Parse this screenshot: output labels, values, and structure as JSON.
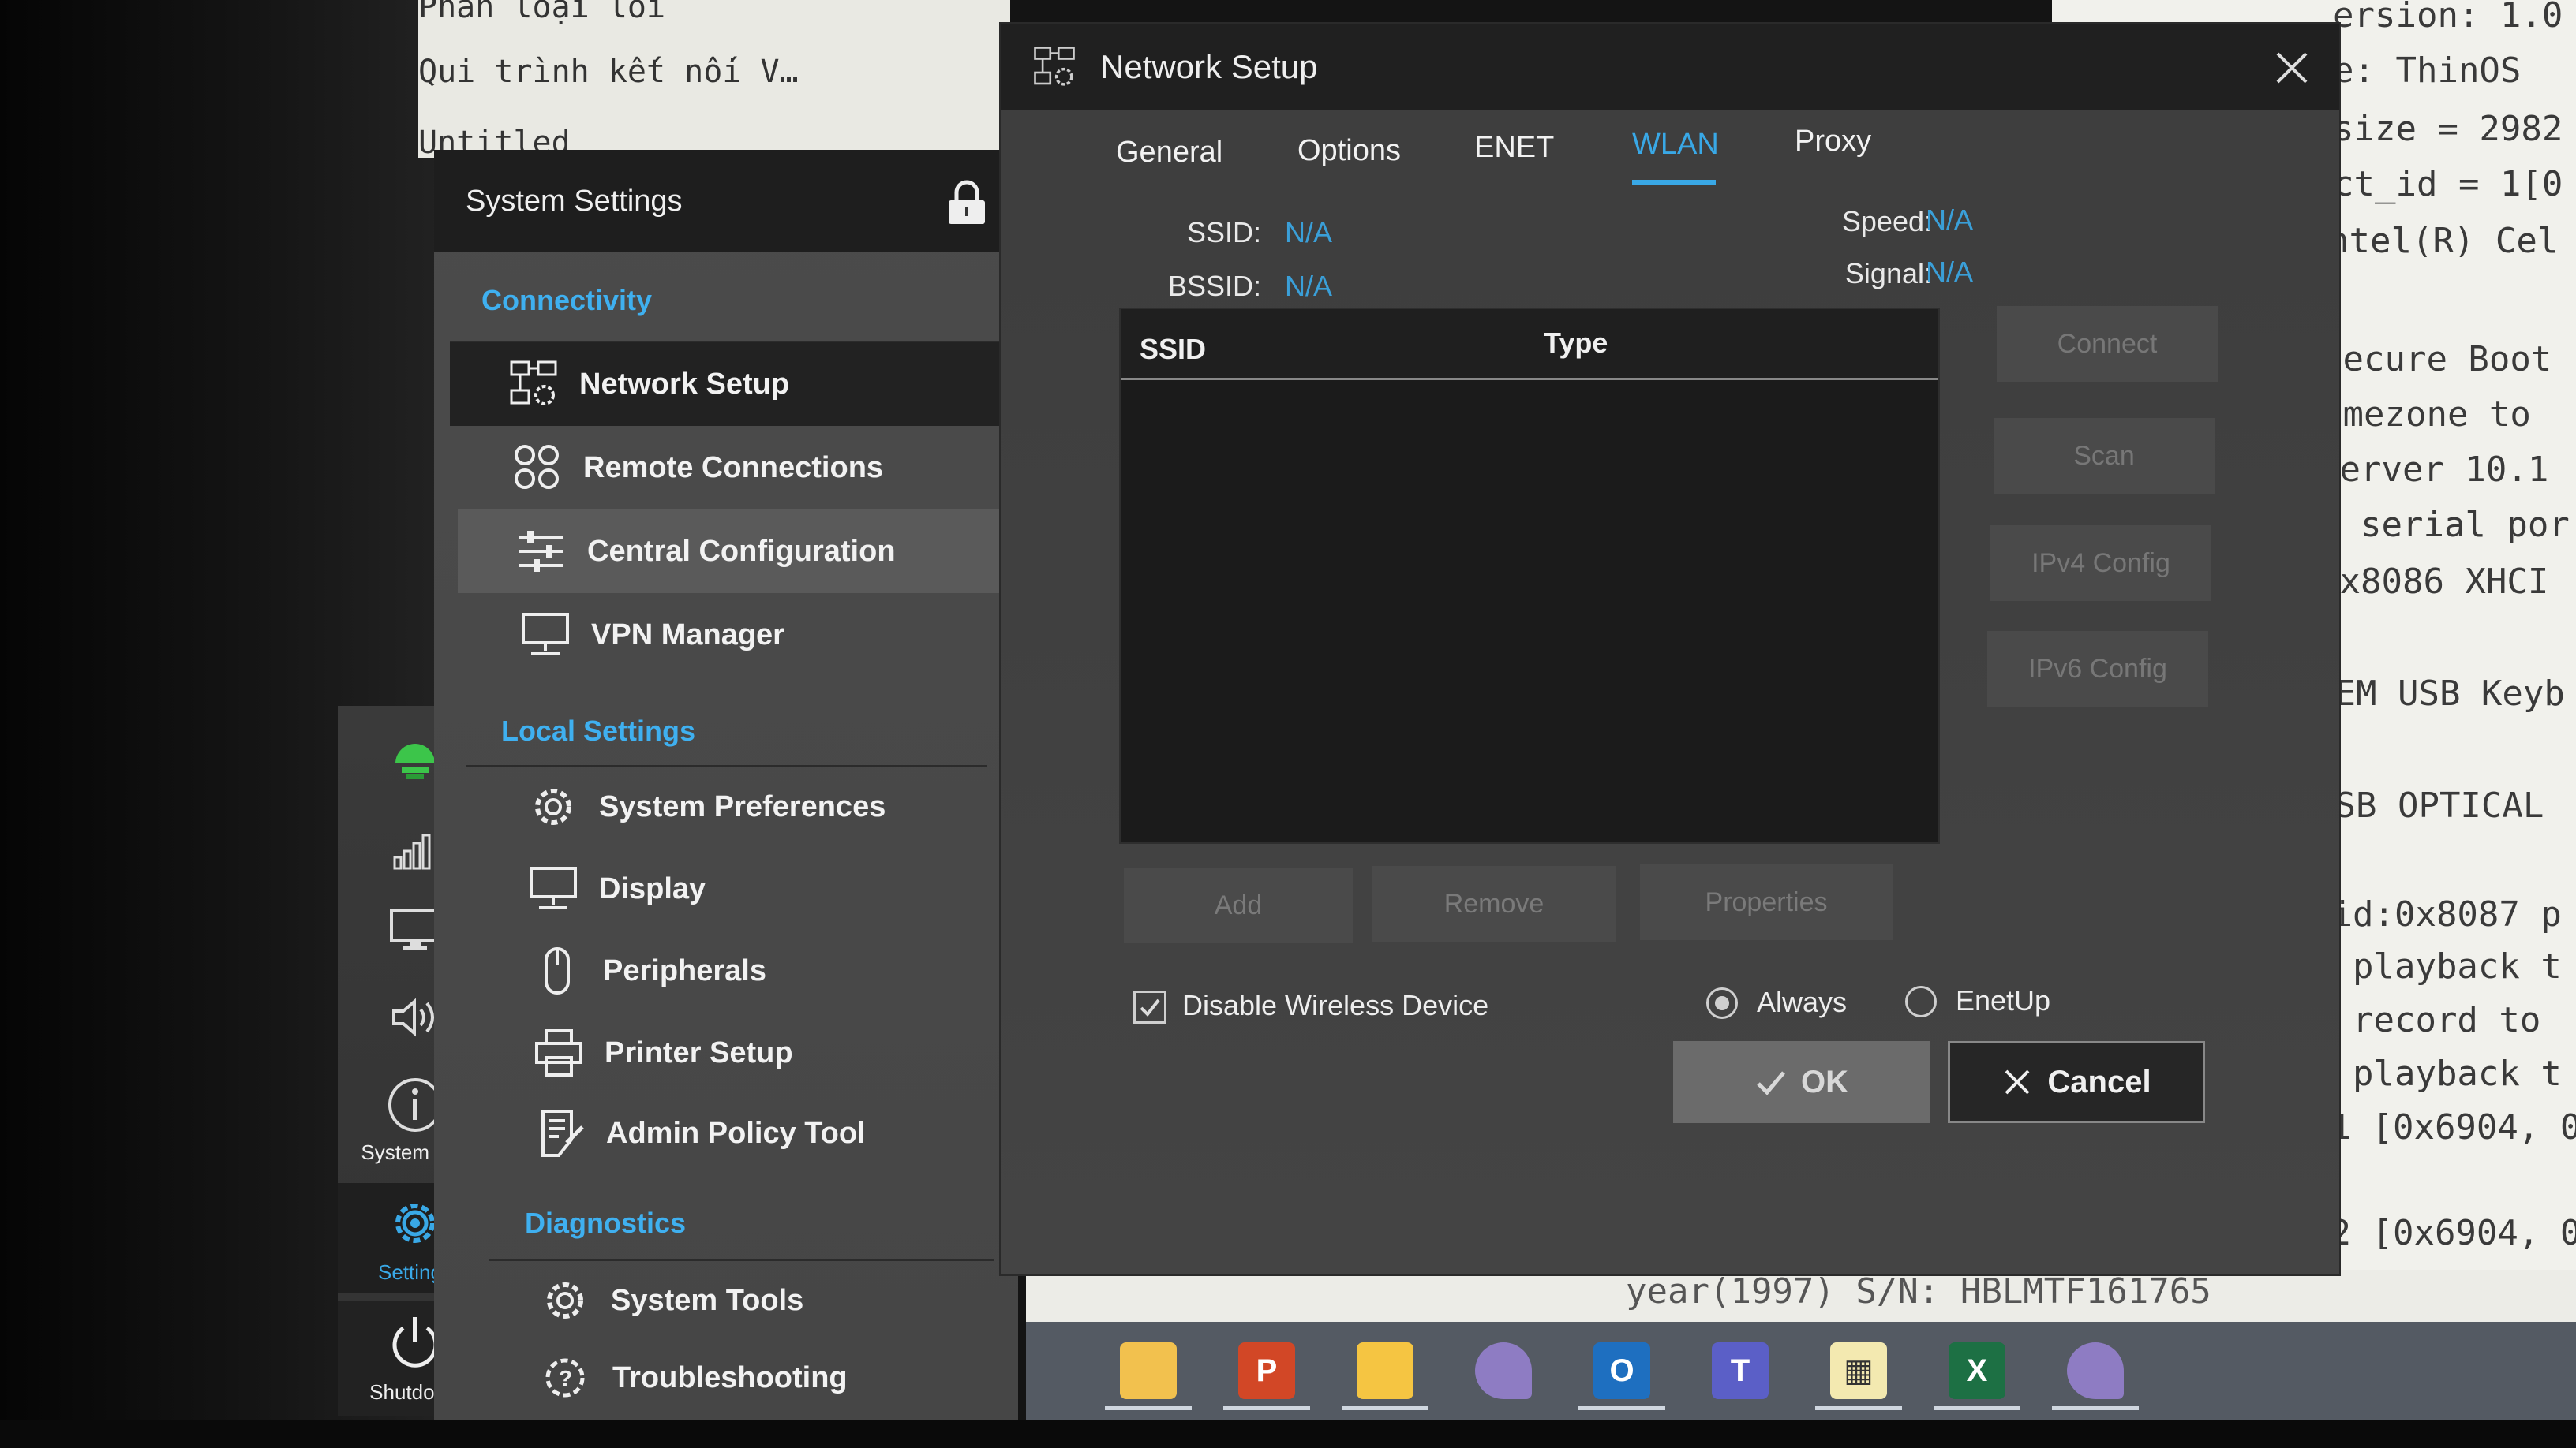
{
  "background": {
    "doc_lines": [
      "Phân loại lỗi",
      "Qui trình kết nối V…",
      "Untitled"
    ],
    "terminal_lines": [
      "ersion: 1.0",
      "e: ThinOS",
      "size = 2982",
      "ct_id = 1[0",
      "ntel(R) Cel",
      "Secure Boot",
      "imezone to",
      "server 10.1",
      "l serial por",
      "0x8086 XHCI",
      "SEM USB Keyb",
      "USB OPTICAL",
      "vid:0x8087 p",
      "e playback t",
      "e record to",
      "e playback t",
      "n1 [0x6904, 0",
      "n2 [0x6904, 0"
    ],
    "status_line": "year(1997) S/N: HBLMTF161765"
  },
  "icon_rail": {
    "items": [
      {
        "icon": "network-status-icon"
      },
      {
        "icon": "signal-bars-icon"
      },
      {
        "icon": "monitor-icon"
      },
      {
        "icon": "speaker-icon"
      },
      {
        "icon": "info-icon",
        "label": "System Info"
      },
      {
        "icon": "gear-icon",
        "label": "Settings"
      },
      {
        "icon": "power-icon",
        "label": "Shutdown"
      }
    ]
  },
  "settings_panel": {
    "title": "System Settings",
    "sections": {
      "connectivity": "Connectivity",
      "local_settings": "Local Settings",
      "diagnostics": "Diagnostics"
    },
    "items": {
      "network_setup": "Network Setup",
      "remote_connections": "Remote Connections",
      "central_configuration": "Central Configuration",
      "vpn_manager": "VPN Manager",
      "system_preferences": "System Preferences",
      "display": "Display",
      "peripherals": "Peripherals",
      "printer_setup": "Printer Setup",
      "admin_policy_tool": "Admin Policy Tool",
      "system_tools": "System Tools",
      "troubleshooting": "Troubleshooting"
    }
  },
  "dialog": {
    "title": "Network Setup",
    "tabs": [
      "General",
      "Options",
      "ENET",
      "WLAN",
      "Proxy"
    ],
    "active_tab": "WLAN",
    "info": {
      "ssid_label": "SSID:",
      "ssid_value": "N/A",
      "bssid_label": "BSSID:",
      "bssid_value": "N/A",
      "speed_label": "Speed:",
      "speed_value": "N/A",
      "signal_label": "Signal:",
      "signal_value": "N/A"
    },
    "table": {
      "columns": [
        "SSID",
        "Type"
      ],
      "rows": []
    },
    "side_buttons": {
      "connect": "Connect",
      "scan": "Scan",
      "ipv4": "IPv4 Config",
      "ipv6": "IPv6 Config"
    },
    "bottom_buttons": {
      "add": "Add",
      "remove": "Remove",
      "properties": "Properties"
    },
    "disable_wireless": {
      "label": "Disable Wireless Device",
      "checked": true
    },
    "radio": {
      "always": "Always",
      "enetup": "EnetUp",
      "selected": "Always"
    },
    "ok": "OK",
    "cancel": "Cancel"
  },
  "taskbar": {
    "apps": [
      {
        "icon": "file-explorer-icon",
        "color": "#f2c14e"
      },
      {
        "icon": "powerpoint-icon",
        "color": "#d24726"
      },
      {
        "icon": "notes-icon",
        "color": "#f5c542"
      },
      {
        "icon": "feather-app-icon",
        "color": "#8e7cc3"
      },
      {
        "icon": "outlook-icon",
        "color": "#1e6fc0"
      },
      {
        "icon": "teams-icon",
        "color": "#5b5fc7"
      },
      {
        "icon": "media-app-icon",
        "color": "#f3e9b0"
      },
      {
        "icon": "excel-icon",
        "color": "#1d7044"
      },
      {
        "icon": "feather-app-icon-2",
        "color": "#8e7cc3"
      }
    ]
  }
}
